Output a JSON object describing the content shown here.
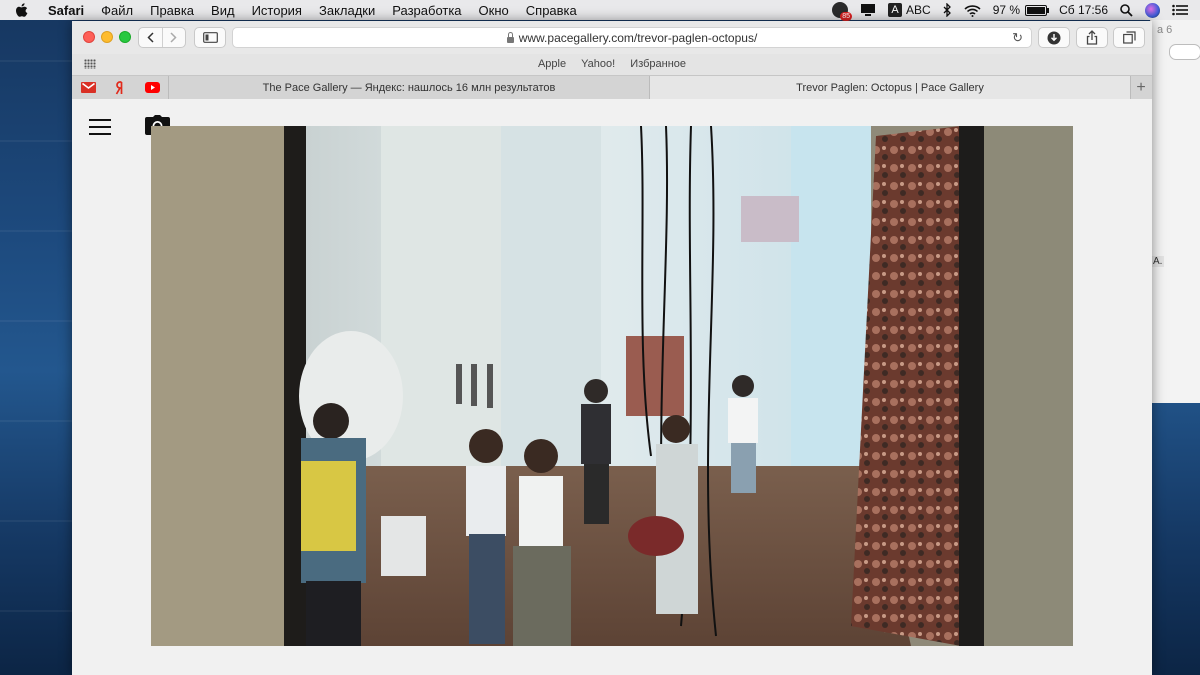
{
  "menubar": {
    "app": "Safari",
    "items": [
      "Файл",
      "Правка",
      "Вид",
      "История",
      "Закладки",
      "Разработка",
      "Окно",
      "Справка"
    ],
    "notification_count": "85",
    "input_source_letter": "A",
    "input_source": "ABC",
    "battery": "97 %",
    "battery_level": 0.97,
    "clock": "Сб 17:56"
  },
  "background_window": {
    "partial_text": "а 6",
    "partial_letter": "A."
  },
  "safari": {
    "url": "www.pacegallery.com/trevor-paglen-octopus/",
    "favorites": [
      "Apple",
      "Yahoo!",
      "Избранное"
    ],
    "tabs": [
      {
        "title": "The Pace Gallery — Яндекс: нашлось 16 млн результатов",
        "active": false
      },
      {
        "title": "Trevor Paglen: Octopus | Pace Gallery",
        "active": true
      }
    ]
  },
  "colors": {
    "gmail": "#d93025",
    "yandex": "#e12a1c",
    "youtube": "#ff0000"
  }
}
